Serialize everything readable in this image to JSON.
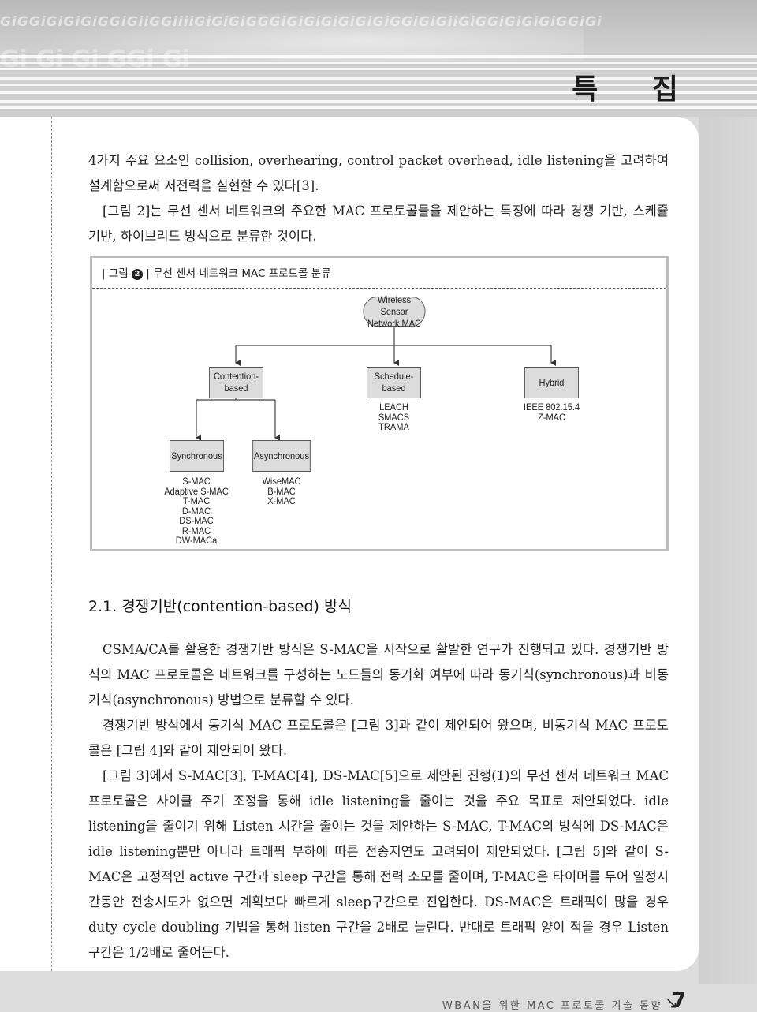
{
  "header": {
    "banner_pattern": "GiGGiGiGiGiGGiGiiGGiiiiGiGiGiGGGiGiGiGiGiGiGiGGiGiGiiGiGGiGiGiGiGGiGi",
    "section_tag": "특 집"
  },
  "body": {
    "intro_paragraphs": [
      "4가지 주요 요소인 collision, overhearing, control packet overhead, idle listening을 고려하여 설계함으로써 저전력을 실현할 수 있다[3].",
      "[그림 2]는 무선 센서 네트워크의 주요한 MAC 프로토콜들을 제안하는 특징에 따라 경쟁 기반, 스케쥴 기반, 하이브리드 방식으로 분류한 것이다."
    ],
    "section_heading": "2.1. 경쟁기반(contention-based) 방식",
    "section_paragraphs": [
      "CSMA/CA를 활용한 경쟁기반 방식은 S-MAC을 시작으로 활발한 연구가 진행되고 있다. 경쟁기반 방식의 MAC 프로토콜은 네트워크를 구성하는 노드들의 동기화 여부에 따라 동기식(synchronous)과 비동기식(asynchronous) 방법으로 분류할 수 있다.",
      "경쟁기반 방식에서 동기식 MAC 프로토콜은 [그림 3]과 같이 제안되어 왔으며, 비동기식 MAC 프로토콜은 [그림 4]와 같이 제안되어 왔다.",
      "[그림 3]에서 S-MAC[3], T-MAC[4], DS-MAC[5]으로 제안된 진행(1)의 무선 센서 네트워크 MAC 프로토콜은 사이클 주기 조정을 통해 idle listening을 줄이는 것을 주요 목표로 제안되었다. idle listening을 줄이기 위해 Listen 시간을 줄이는 것을 제안하는 S-MAC, T-MAC의 방식에 DS-MAC은 idle listening뿐만 아니라 트래픽 부하에 따른 전송지연도 고려되어 제안되었다. [그림 5]와 같이 S-MAC은 고정적인 active 구간과 sleep 구간을 통해 전력 소모를 줄이며, T-MAC은 타이머를 두어 일정시간동안 전송시도가 없으면 계획보다 빠르게 sleep구간으로 진입한다. DS-MAC은 트래픽이 많을 경우 duty cycle doubling 기법을 통해 listen 구간을 2배로 늘린다. 반대로 트래픽 양이 적을 경우 Listen 구간은 1/2배로 줄어든다."
    ]
  },
  "figure": {
    "caption_prefix": "| 그림",
    "caption_number": "2",
    "caption_text": "| 무선 센서 네트워크 MAC 프로토콜 분류",
    "root": {
      "line1": "Wireless Sensor",
      "line2": "Network MAC"
    },
    "categories": [
      {
        "line1": "Contention-",
        "line2": "based",
        "examples": []
      },
      {
        "line1": "Schedule-",
        "line2": "based",
        "examples": [
          "LEACH",
          "SMACS",
          "TRAMA"
        ]
      },
      {
        "line1": "Hybrid",
        "line2": "",
        "examples": [
          "IEEE 802.15.4",
          "Z-MAC"
        ]
      }
    ],
    "subcategories": [
      {
        "label": "Synchronous",
        "examples": [
          "S-MAC",
          "Adaptive S-MAC",
          "T-MAC",
          "D-MAC",
          "DS-MAC",
          "R-MAC",
          "DW-MACa"
        ]
      },
      {
        "label": "Asynchronous",
        "examples": [
          "WiseMAC",
          "B-MAC",
          "X-MAC"
        ]
      }
    ]
  },
  "footer": {
    "running_title": "WBAN을 위한 MAC 프로토콜 기술 동향",
    "arrow_glyph": "↘",
    "page_number": "7"
  }
}
